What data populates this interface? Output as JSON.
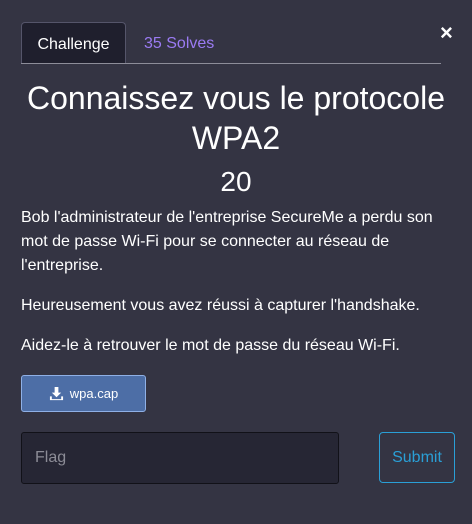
{
  "modal": {
    "close_glyph": "×",
    "tabs": [
      {
        "label": "Challenge",
        "active": true
      },
      {
        "label": "35 Solves",
        "active": false
      }
    ],
    "title": "Connaissez vous le protocole WPA2",
    "points": "20",
    "description": [
      "Bob l'administrateur de l'entreprise SecureMe a perdu son mot de passe Wi-Fi pour se connecter au réseau de l'entreprise.",
      "Heureusement vous avez réussi à capturer l'handshake.",
      "Aidez-le à retrouver le mot de passe du réseau Wi-Fi."
    ],
    "file": {
      "name": "wpa.cap",
      "icon": "download-icon"
    },
    "flag_input": {
      "placeholder": "Flag",
      "value": ""
    },
    "submit_label": "Submit"
  },
  "colors": {
    "background": "#343443",
    "tab_active_bg": "#1f1f2d",
    "solves_link": "#9b7bf3",
    "file_button": "#4d6ea6",
    "submit_accent": "#2a9fd6"
  }
}
